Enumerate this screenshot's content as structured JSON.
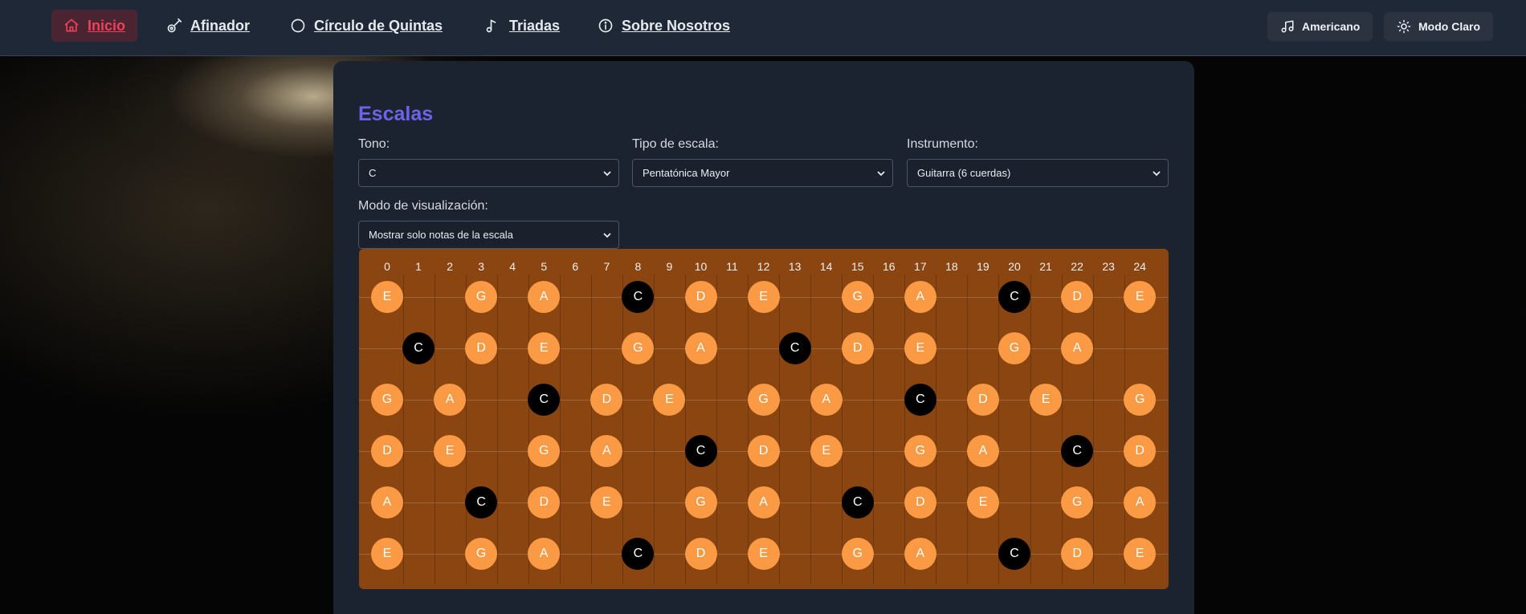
{
  "nav": {
    "items": [
      {
        "label": "Inicio",
        "icon": "home-icon",
        "active": true
      },
      {
        "label": "Afinador",
        "icon": "guitar-icon",
        "active": false
      },
      {
        "label": "Círculo de Quintas",
        "icon": "circle-icon",
        "active": false
      },
      {
        "label": "Triadas",
        "icon": "music-note-icon",
        "active": false
      },
      {
        "label": "Sobre Nosotros",
        "icon": "info-icon",
        "active": false
      }
    ],
    "notation_button": "Americano",
    "theme_button": "Modo Claro"
  },
  "scales": {
    "title": "Escalas",
    "key_label": "Tono:",
    "key_value": "C",
    "scale_type_label": "Tipo de escala:",
    "scale_type_value": "Pentatónica Mayor",
    "instrument_label": "Instrumento:",
    "instrument_value": "Guitarra (6 cuerdas)",
    "display_mode_label": "Modo de visualización:",
    "display_mode_value": "Mostrar solo notas de la escala"
  },
  "fretboard": {
    "frets": [
      "0",
      "1",
      "2",
      "3",
      "4",
      "5",
      "6",
      "7",
      "8",
      "9",
      "10",
      "11",
      "12",
      "13",
      "14",
      "15",
      "16",
      "17",
      "18",
      "19",
      "20",
      "21",
      "22",
      "23",
      "24"
    ],
    "root_note": "C",
    "strings": [
      {
        "notes": [
          [
            0,
            "E"
          ],
          [
            3,
            "G"
          ],
          [
            5,
            "A"
          ],
          [
            8,
            "C"
          ],
          [
            10,
            "D"
          ],
          [
            12,
            "E"
          ],
          [
            15,
            "G"
          ],
          [
            17,
            "A"
          ],
          [
            20,
            "C"
          ],
          [
            22,
            "D"
          ],
          [
            24,
            "E"
          ]
        ]
      },
      {
        "notes": [
          [
            1,
            "C"
          ],
          [
            3,
            "D"
          ],
          [
            5,
            "E"
          ],
          [
            8,
            "G"
          ],
          [
            10,
            "A"
          ],
          [
            13,
            "C"
          ],
          [
            15,
            "D"
          ],
          [
            17,
            "E"
          ],
          [
            20,
            "G"
          ],
          [
            22,
            "A"
          ]
        ]
      },
      {
        "notes": [
          [
            0,
            "G"
          ],
          [
            2,
            "A"
          ],
          [
            5,
            "C"
          ],
          [
            7,
            "D"
          ],
          [
            9,
            "E"
          ],
          [
            12,
            "G"
          ],
          [
            14,
            "A"
          ],
          [
            17,
            "C"
          ],
          [
            19,
            "D"
          ],
          [
            21,
            "E"
          ],
          [
            24,
            "G"
          ]
        ]
      },
      {
        "notes": [
          [
            0,
            "D"
          ],
          [
            2,
            "E"
          ],
          [
            5,
            "G"
          ],
          [
            7,
            "A"
          ],
          [
            10,
            "C"
          ],
          [
            12,
            "D"
          ],
          [
            14,
            "E"
          ],
          [
            17,
            "G"
          ],
          [
            19,
            "A"
          ],
          [
            22,
            "C"
          ],
          [
            24,
            "D"
          ]
        ]
      },
      {
        "notes": [
          [
            0,
            "A"
          ],
          [
            3,
            "C"
          ],
          [
            5,
            "D"
          ],
          [
            7,
            "E"
          ],
          [
            10,
            "G"
          ],
          [
            12,
            "A"
          ],
          [
            15,
            "C"
          ],
          [
            17,
            "D"
          ],
          [
            19,
            "E"
          ],
          [
            22,
            "G"
          ],
          [
            24,
            "A"
          ]
        ]
      },
      {
        "notes": [
          [
            0,
            "E"
          ],
          [
            3,
            "G"
          ],
          [
            5,
            "A"
          ],
          [
            8,
            "C"
          ],
          [
            10,
            "D"
          ],
          [
            12,
            "E"
          ],
          [
            15,
            "G"
          ],
          [
            17,
            "A"
          ],
          [
            20,
            "C"
          ],
          [
            22,
            "D"
          ],
          [
            24,
            "E"
          ]
        ]
      }
    ]
  }
}
